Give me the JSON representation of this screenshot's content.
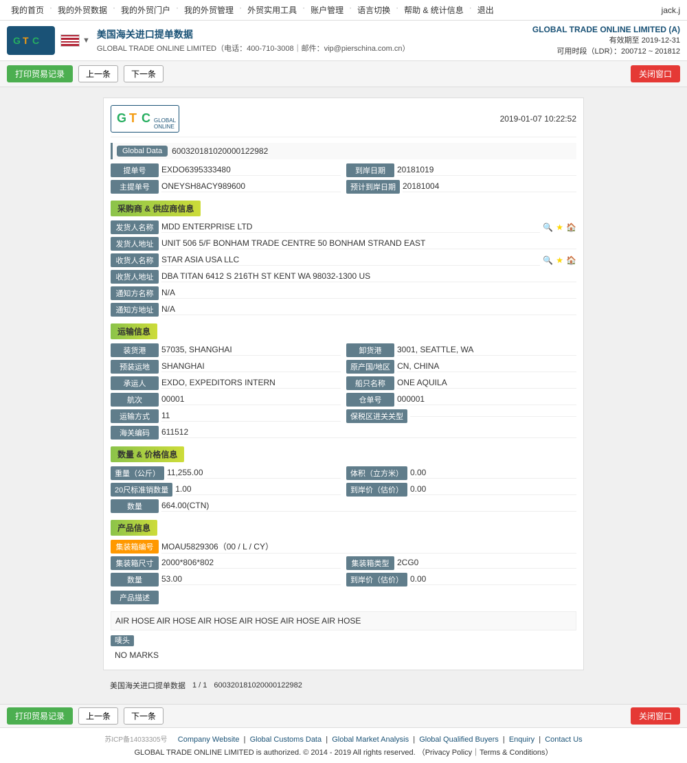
{
  "nav": {
    "items": [
      "我的首页",
      "我的外贸数据",
      "我的外贸门户",
      "我的外贸管理",
      "外贸实用工具",
      "账户管理",
      "语言切换",
      "帮助 & 统计信息",
      "退出"
    ],
    "user": "jack.j"
  },
  "header": {
    "page_title": "美国海关进口提单数据",
    "company_line1": "GLOBAL TRADE ONLINE LIMITED（电话：400-710-3008｜邮件：vip@pierschina.com.cn）",
    "gtc_name": "GLOBAL TRADE ONLINE LIMITED (A)",
    "valid_until": "有效期至 2019-12-31",
    "ldr": "可用时段（LDR）：200712 ~ 201812"
  },
  "actions": {
    "print": "打印贸易记录",
    "prev": "上一条",
    "next": "下一条",
    "close": "关闭窗口"
  },
  "record": {
    "datetime": "2019-01-07 10:22:52",
    "global_data_label": "Global Data",
    "global_data_value": "600320181020000122982",
    "bill_no_label": "提单号",
    "bill_no_value": "EXDO6395333480",
    "arrival_date_label": "到岸日期",
    "arrival_date_value": "20181019",
    "master_bill_label": "主提单号",
    "master_bill_value": "ONEYSH8ACY989600",
    "planned_arrival_label": "预计到岸日期",
    "planned_arrival_value": "20181004"
  },
  "supplier": {
    "section_title": "采购商 & 供应商信息",
    "shipper_name_label": "发货人名称",
    "shipper_name_value": "MDD ENTERPRISE LTD",
    "shipper_addr_label": "发货人地址",
    "shipper_addr_value": "UNIT 506 5/F BONHAM TRADE CENTRE 50 BONHAM STRAND EAST",
    "consignee_name_label": "收货人名称",
    "consignee_name_value": "STAR ASIA USA LLC",
    "consignee_addr_label": "收货人地址",
    "consignee_addr_value": "DBA TITAN 6412 S 216TH ST KENT WA 98032-1300 US",
    "notify_name_label": "通知方名称",
    "notify_name_value": "N/A",
    "notify_addr_label": "通知方地址",
    "notify_addr_value": "N/A"
  },
  "transport": {
    "section_title": "运输信息",
    "departure_port_label": "装货港",
    "departure_port_value": "57035, SHANGHAI",
    "arrival_port_label": "卸货港",
    "arrival_port_value": "3001, SEATTLE, WA",
    "loading_place_label": "预装运地",
    "loading_place_value": "SHANGHAI",
    "origin_label": "原产国/地区",
    "origin_value": "CN, CHINA",
    "carrier_label": "承运人",
    "carrier_value": "EXDO, EXPEDITORS INTERN",
    "vessel_label": "船只名称",
    "vessel_value": "ONE AQUILA",
    "voyage_label": "航次",
    "voyage_value": "00001",
    "manifest_label": "仓单号",
    "manifest_value": "000001",
    "transport_mode_label": "运输方式",
    "transport_mode_value": "11",
    "customs_zone_label": "保税区进关关型",
    "customs_zone_value": "",
    "customs_code_label": "海关编码",
    "customs_code_value": "611512"
  },
  "quantity": {
    "section_title": "数量 & 价格信息",
    "weight_label": "重量（公斤）",
    "weight_value": "11,255.00",
    "volume_label": "体积（立方米）",
    "volume_value": "0.00",
    "container20_label": "20尺标准销数量",
    "container20_value": "1.00",
    "arrival_price_label": "到岸价（估价）",
    "arrival_price_value": "0.00",
    "qty_label": "数量",
    "qty_value": "664.00(CTN)"
  },
  "product": {
    "section_title": "产品信息",
    "container_no_label": "集装箱编号",
    "container_no_value": "MOAU5829306（00 / L / CY）",
    "container_size_label": "集装箱尺寸",
    "container_size_value": "2000*806*802",
    "container_type_label": "集装箱类型",
    "container_type_value": "2CG0",
    "qty_label": "数量",
    "qty_value": "53.00",
    "price_label": "到岸价（估价）",
    "price_value": "0.00",
    "desc_title": "产品描述",
    "desc_value": "AIR HOSE AIR HOSE AIR HOSE AIR HOSE AIR HOSE AIR HOSE",
    "marks_label": "唛头",
    "marks_value": "NO MARKS"
  },
  "bottom_bar": {
    "page_title": "美国海关进口提单数据",
    "page_info": "1 / 1",
    "record_id": "600320181020000122982"
  },
  "footer": {
    "icp": "苏ICP备14033305号",
    "links": [
      "Company Website",
      "Global Customs Data",
      "Global Market Analysis",
      "Global Qualified Buyers",
      "Enquiry",
      "Contact Us"
    ],
    "copyright": "GLOBAL TRADE ONLINE LIMITED is authorized. © 2014 - 2019 All rights reserved. （Privacy Policy｜Terms & Conditions）"
  }
}
